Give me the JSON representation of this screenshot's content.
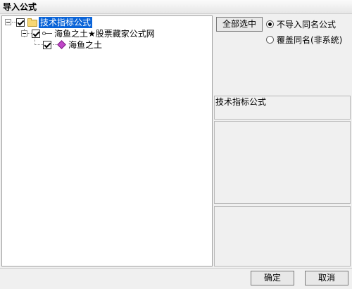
{
  "window": {
    "title": "导入公式"
  },
  "tree": {
    "root": {
      "label": "技术指标公式",
      "checked": true,
      "selected": true,
      "icon": "folder-icon"
    },
    "child": {
      "label": "海鱼之土★股票藏家公式网",
      "checked": true,
      "icon": "key-icon"
    },
    "leaf": {
      "label": "海鱼之土",
      "checked": true,
      "icon": "gem-icon"
    }
  },
  "options": {
    "select_all_label": "全部选中",
    "radio_skip_label": "不导入同名公式",
    "radio_overwrite_label": "覆盖同名(非系统)",
    "selected": "skip"
  },
  "detail": {
    "formula_type": "技术指标公式"
  },
  "footer": {
    "ok_label": "确定",
    "cancel_label": "取消"
  },
  "colors": {
    "selection": "#0a64d8",
    "folder": "#f7d774",
    "gem": "#c046c8"
  }
}
